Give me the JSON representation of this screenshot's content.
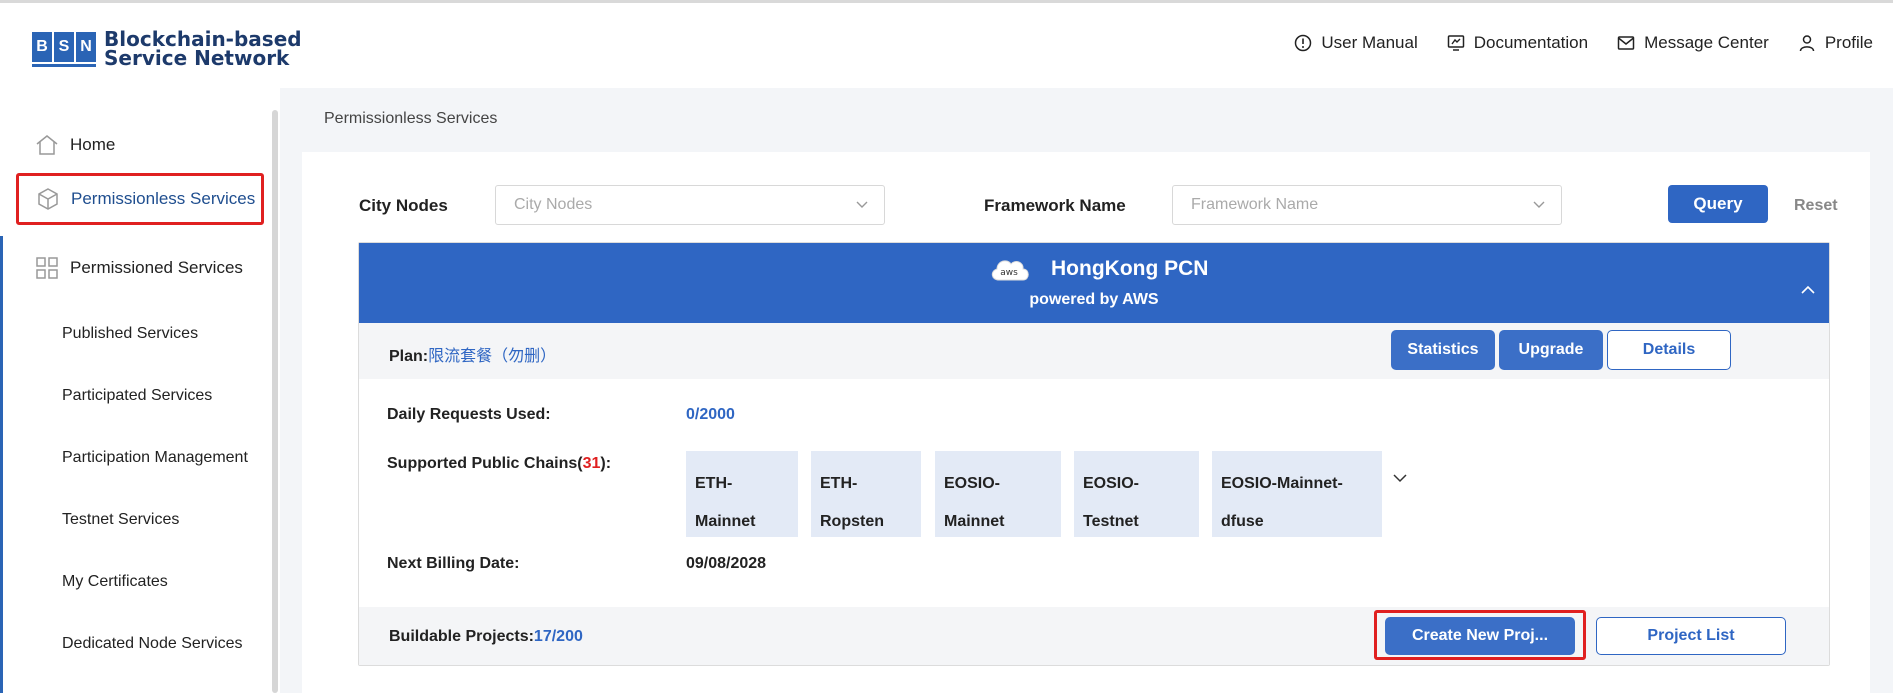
{
  "logo": {
    "letters": [
      "B",
      "S",
      "N"
    ],
    "line1": "Blockchain-based",
    "line2": "Service Network"
  },
  "topnav": [
    {
      "label": "User Manual",
      "icon": "info-circle-icon"
    },
    {
      "label": "Documentation",
      "icon": "document-screen-icon"
    },
    {
      "label": "Message Center",
      "icon": "envelope-icon"
    },
    {
      "label": "Profile",
      "icon": "user-icon"
    }
  ],
  "sidebar": {
    "home": "Home",
    "permissionless": "Permissionless Services",
    "permissioned": "Permissioned Services",
    "items": [
      "Published Services",
      "Participated Services",
      "Participation Management",
      "Testnet Services",
      "My Certificates",
      "Dedicated Node Services"
    ]
  },
  "breadcrumb": "Permissionless Services",
  "filters": {
    "city_label": "City Nodes",
    "city_placeholder": "City Nodes",
    "framework_label": "Framework Name",
    "framework_placeholder": "Framework Name",
    "query": "Query",
    "reset": "Reset"
  },
  "card": {
    "cloud_text": "aws",
    "title": "HongKong PCN",
    "subtitle": "powered by AWS",
    "plan_label": "Plan:",
    "plan_value": "限流套餐（勿删）",
    "buttons": {
      "statistics": "Statistics",
      "upgrade": "Upgrade",
      "details": "Details"
    },
    "daily_label": "Daily Requests Used:",
    "daily_value": "0/2000",
    "chains_label_prefix": "Supported Public Chains(",
    "chains_count": "31",
    "chains_label_suffix": "):",
    "chains": [
      [
        "ETH-",
        "Mainnet"
      ],
      [
        "ETH-",
        "Ropsten"
      ],
      [
        "EOSIO-",
        "Mainnet"
      ],
      [
        "EOSIO-",
        "Testnet"
      ],
      [
        "EOSIO-Mainnet-",
        "dfuse"
      ]
    ],
    "billing_label": "Next Billing Date:",
    "billing_value": "09/08/2028",
    "buildable_label": "Buildable Projects:",
    "buildable_value": "17/200",
    "create_button": "Create New Proj...",
    "project_list_button": "Project List"
  },
  "colors": {
    "primary": "#2f66c3",
    "highlight": "#e02020",
    "chain_bg": "#e3eaf6"
  }
}
